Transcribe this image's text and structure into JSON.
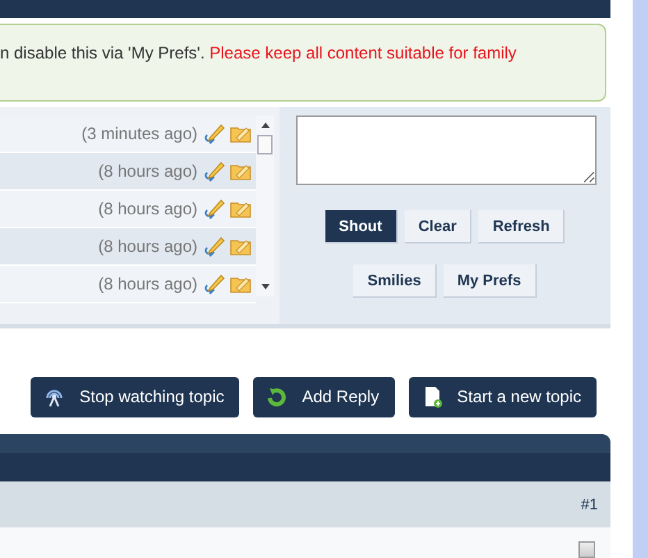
{
  "notice": {
    "text": "n disable this via 'My Prefs'.",
    "warning": "Please keep all content suitable for family"
  },
  "shouts": [
    {
      "time": "(3 minutes ago)"
    },
    {
      "time": "(8 hours ago)"
    },
    {
      "time": "(8 hours ago)"
    },
    {
      "time": "(8 hours ago)"
    },
    {
      "time": "(8 hours ago)"
    }
  ],
  "shout_buttons": [
    {
      "label": "Shout",
      "primary": true
    },
    {
      "label": "Clear",
      "primary": false
    },
    {
      "label": "Refresh",
      "primary": false
    }
  ],
  "shout_buttons_2": [
    {
      "label": "Smilies"
    },
    {
      "label": "My Prefs"
    }
  ],
  "topic_actions": [
    {
      "label": "Stop watching topic",
      "kind": "watch"
    },
    {
      "label": "Add Reply",
      "kind": "reply"
    },
    {
      "label": "Start a new topic",
      "kind": "new"
    }
  ],
  "post": {
    "number": "#1",
    "checked": false
  }
}
